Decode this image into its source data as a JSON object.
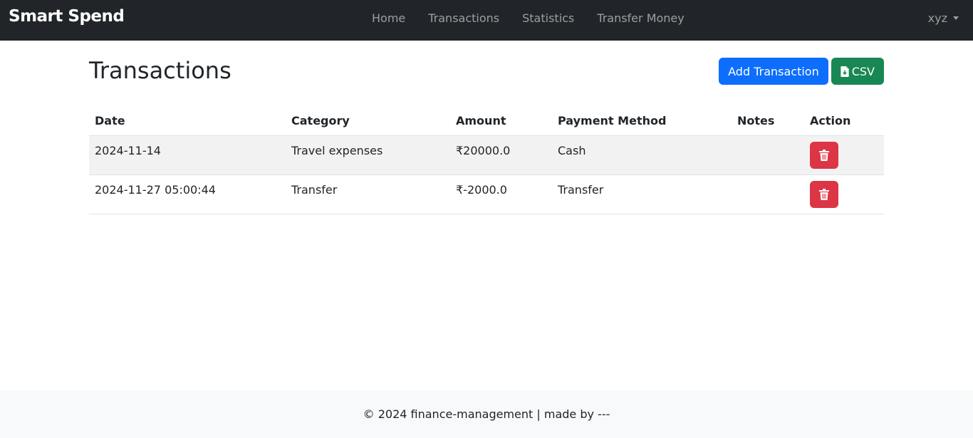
{
  "brand": "Smart Spend",
  "nav": {
    "links": [
      "Home",
      "Transactions",
      "Statistics",
      "Transfer Money"
    ],
    "user": "xyz"
  },
  "page": {
    "title": "Transactions",
    "add_button": "Add Transaction",
    "csv_button": "CSV"
  },
  "table": {
    "headers": [
      "Date",
      "Category",
      "Amount",
      "Payment Method",
      "Notes",
      "Action"
    ],
    "rows": [
      {
        "date": "2024-11-14",
        "category": "Travel expenses",
        "amount": "₹20000.0",
        "method": "Cash",
        "notes": ""
      },
      {
        "date": "2024-11-27 05:00:44",
        "category": "Transfer",
        "amount": "₹-2000.0",
        "method": "Transfer",
        "notes": ""
      }
    ]
  },
  "footer": "© 2024 finance-management | made by ---",
  "colors": {
    "navbar": "#212529",
    "primary": "#0d6efd",
    "success": "#198754",
    "danger": "#dc3545"
  },
  "icons": {
    "csv": "file-download-icon",
    "delete": "trash-icon",
    "user_menu": "caret-down-icon"
  }
}
